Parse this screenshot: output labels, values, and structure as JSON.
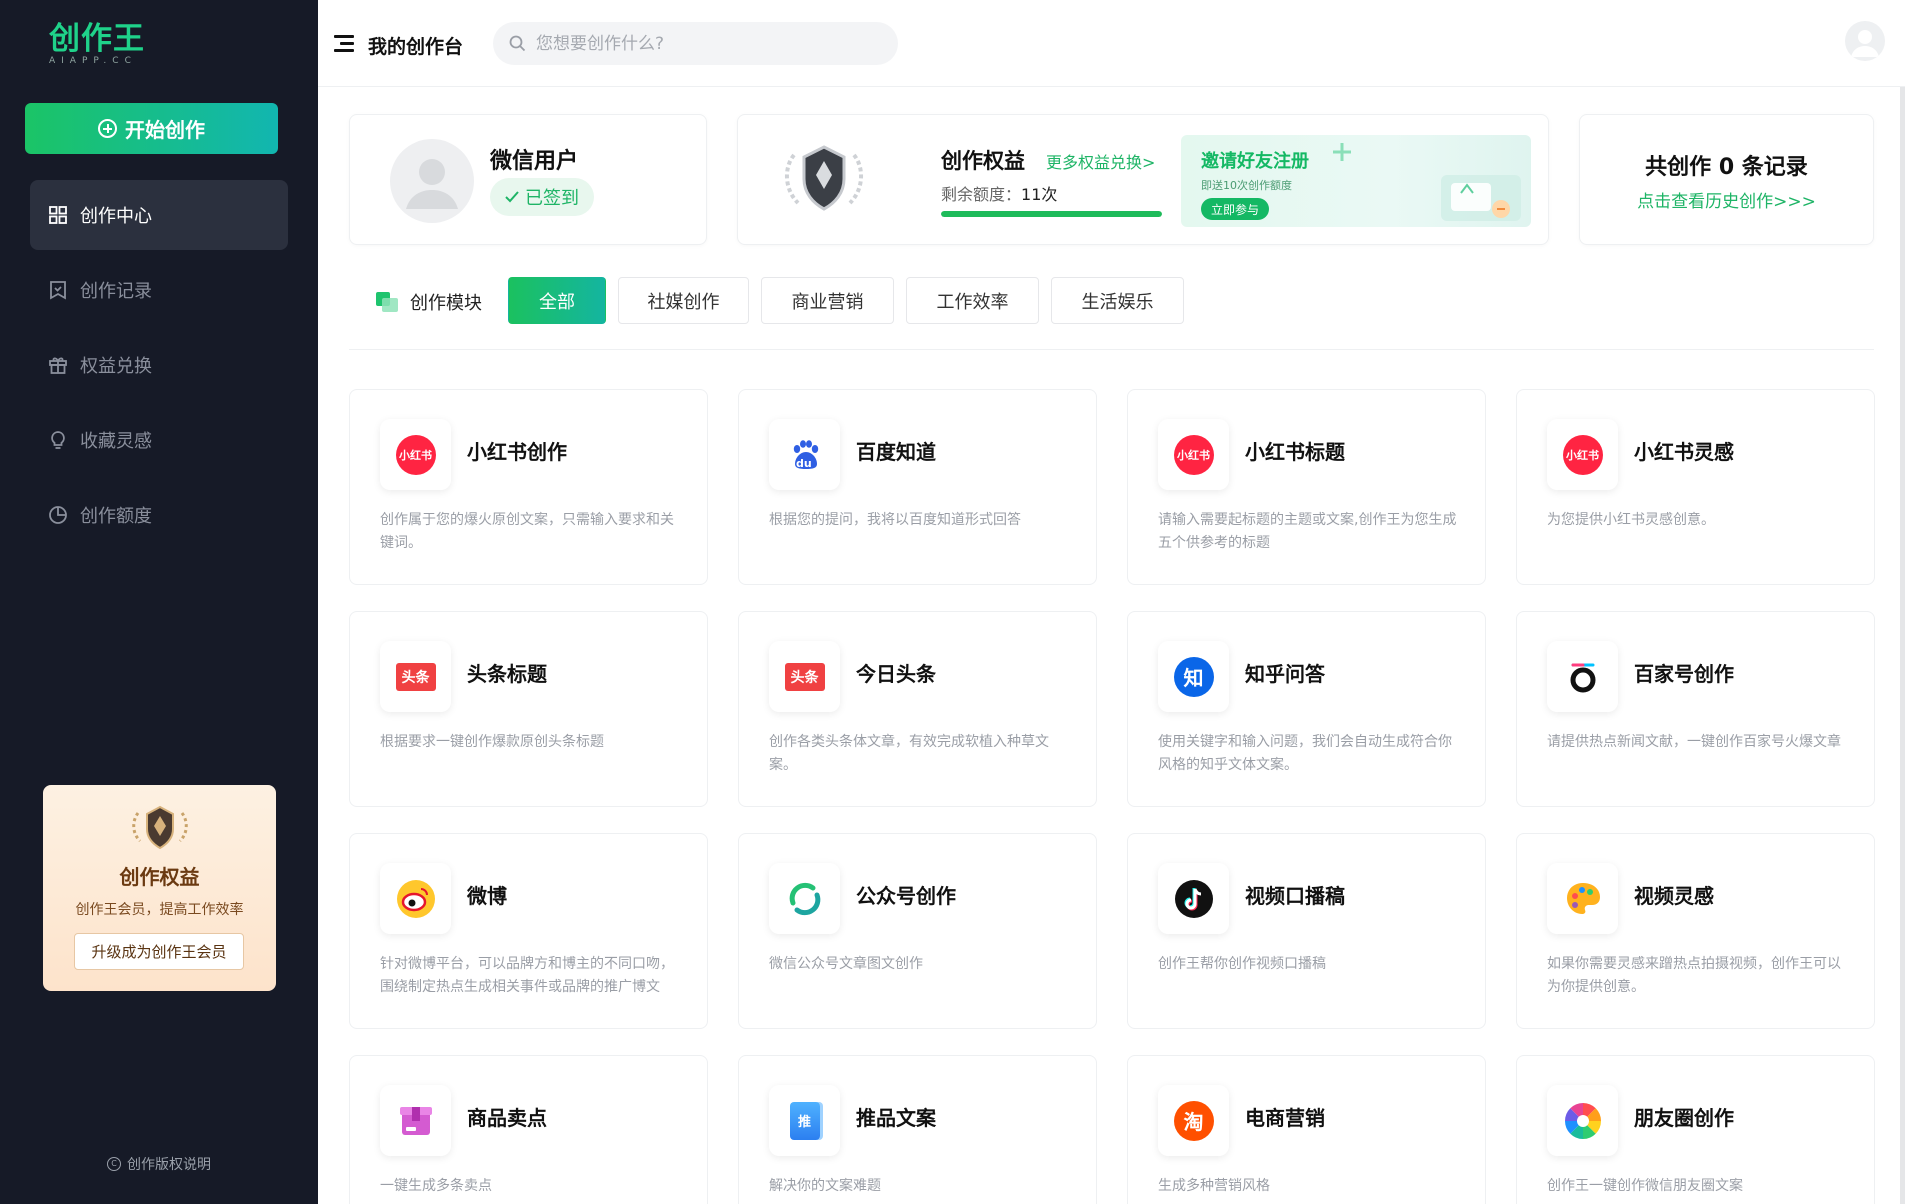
{
  "app": {
    "logo_main": "创作王",
    "logo_sub": "AIAPP.CC"
  },
  "sidebar": {
    "start_label": "开始创作",
    "items": [
      {
        "label": "创作中心",
        "icon": "grid-icon",
        "active": true
      },
      {
        "label": "创作记录",
        "icon": "bookmark-icon",
        "active": false
      },
      {
        "label": "权益兑换",
        "icon": "gift-icon",
        "active": false
      },
      {
        "label": "收藏灵感",
        "icon": "lightbulb-icon",
        "active": false
      },
      {
        "label": "创作额度",
        "icon": "pie-chart-icon",
        "active": false
      }
    ],
    "promo": {
      "title": "创作权益",
      "subtitle": "创作王会员，提高工作效率",
      "button": "升级成为创作王会员"
    },
    "copyright": "创作版权说明"
  },
  "header": {
    "title": "我的创作台",
    "search_placeholder": "您想要创作什么?"
  },
  "user": {
    "name": "微信用户",
    "signed_label": "已签到"
  },
  "rights": {
    "title": "创作权益",
    "more_link": "更多权益兑换>",
    "remain_label": "剩余额度：",
    "remain_value": "11次",
    "remain_fraction": 1.0,
    "invite_title": "邀请好友注册",
    "invite_sub": "即送10次创作额度",
    "invite_button": "立即参与"
  },
  "records": {
    "title": "共创作 0 条记录",
    "link": "点击查看历史创作>>>"
  },
  "modules": {
    "label": "创作模块",
    "tabs": [
      {
        "label": "全部",
        "active": true
      },
      {
        "label": "社媒创作",
        "active": false
      },
      {
        "label": "商业营销",
        "active": false
      },
      {
        "label": "工作效率",
        "active": false
      },
      {
        "label": "生活娱乐",
        "active": false
      }
    ]
  },
  "tools": [
    {
      "title": "小红书创作",
      "desc": "创作属于您的爆火原创文案，只需输入要求和关键词。",
      "icon": "xiaohongshu-icon"
    },
    {
      "title": "百度知道",
      "desc": "根据您的提问，我将以百度知道形式回答",
      "icon": "baidu-icon"
    },
    {
      "title": "小红书标题",
      "desc": "请输入需要起标题的主题或文案,创作王为您生成五个供参考的标题",
      "icon": "xiaohongshu-icon"
    },
    {
      "title": "小红书灵感",
      "desc": "为您提供小红书灵感创意。",
      "icon": "xiaohongshu-icon"
    },
    {
      "title": "头条标题",
      "desc": "根据要求一键创作爆款原创头条标题",
      "icon": "toutiao-icon"
    },
    {
      "title": "今日头条",
      "desc": "创作各类头条体文章，有效完成软植入种草文案。",
      "icon": "toutiao-icon"
    },
    {
      "title": "知乎问答",
      "desc": "使用关键字和输入问题，我们会自动生成符合你风格的知乎文体文案。",
      "icon": "zhihu-icon"
    },
    {
      "title": "百家号创作",
      "desc": "请提供热点新闻文献，一键创作百家号火爆文章",
      "icon": "baijiahao-icon"
    },
    {
      "title": "微博",
      "desc": "针对微博平台，可以品牌方和博主的不同口吻，围绕制定热点生成相关事件或品牌的推广博文",
      "icon": "weibo-icon"
    },
    {
      "title": "公众号创作",
      "desc": "微信公众号文章图文创作",
      "icon": "wechat-mp-icon"
    },
    {
      "title": "视频口播稿",
      "desc": "创作王帮你创作视频口播稿",
      "icon": "douyin-icon"
    },
    {
      "title": "视频灵感",
      "desc": "如果你需要灵感来蹭热点拍摄视频，创作王可以为你提供创意。",
      "icon": "palette-icon"
    },
    {
      "title": "商品卖点",
      "desc": "一键生成多条卖点",
      "icon": "box-icon"
    },
    {
      "title": "推品文案",
      "desc": "解决你的文案难题",
      "icon": "notebook-icon"
    },
    {
      "title": "电商营销",
      "desc": "生成多种营销风格",
      "icon": "taobao-icon"
    },
    {
      "title": "朋友圈创作",
      "desc": "创作王一键创作微信朋友圈文案",
      "icon": "moments-icon"
    }
  ],
  "icon_text": {
    "xiaohongshu": "小红书",
    "baidu": "du",
    "toutiao": "头条",
    "zhihu": "知",
    "taobao": "淘",
    "notebook": "推"
  },
  "colors": {
    "accent": "#1eb466",
    "sidebar_bg": "#161a27",
    "xiaohongshu": "#ff2442",
    "toutiao": "#f04142",
    "zhihu": "#0a66e8",
    "taobao": "#ff5000"
  }
}
